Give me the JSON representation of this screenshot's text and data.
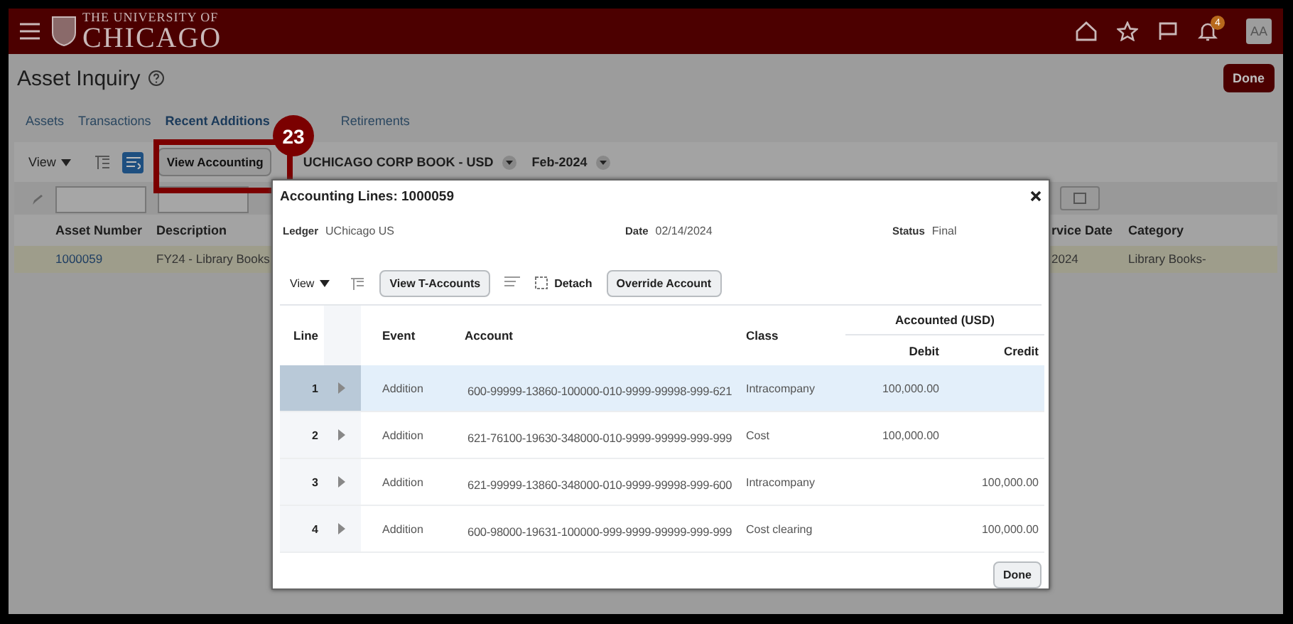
{
  "header": {
    "logo_line1": "THE UNIVERSITY OF",
    "logo_line2": "CHICAGO",
    "notification_count": "4",
    "avatar": "AA"
  },
  "page": {
    "title": "Asset Inquiry",
    "done_button": "Done",
    "tabs": [
      {
        "label": "Assets",
        "selected": false
      },
      {
        "label": "Transactions",
        "selected": false
      },
      {
        "label": "Recent Additions",
        "selected": true
      },
      {
        "label": "Retirements",
        "selected": false
      }
    ],
    "toolbar": {
      "view_menu": "View",
      "view_accounting_button": "View Accounting",
      "book": "UCHICAGO CORP BOOK - USD",
      "period": "Feb-2024"
    },
    "table": {
      "columns": [
        "Asset Number",
        "Description",
        "rvice Date",
        "Category"
      ],
      "rows": [
        {
          "cells": [
            "1000059",
            "FY24 - Library Books",
            "2024",
            "Library Books-"
          ],
          "selected": true
        }
      ]
    }
  },
  "callout": {
    "number": "23"
  },
  "dialog": {
    "title": "Accounting Lines: 1000059",
    "fields": [
      {
        "label": "Ledger",
        "value": "UChicago US"
      },
      {
        "label": "Date",
        "value": "02/14/2024"
      },
      {
        "label": "Status",
        "value": "Final"
      }
    ],
    "toolbar": {
      "view_menu": "View",
      "buttons": [
        {
          "label": "View T-Accounts",
          "kind": "button"
        },
        {
          "label": "Detach",
          "kind": "icon-text"
        },
        {
          "label": "Override Account",
          "kind": "button"
        }
      ]
    },
    "columns": {
      "line": "Line",
      "event": "Event",
      "account": "Account",
      "class": "Class",
      "group": "Accounted (USD)",
      "debit": "Debit",
      "credit": "Credit"
    },
    "rows": [
      {
        "line": "1",
        "event": "Addition",
        "account": "600-99999-13860-100000-010-9999-99998-999-621",
        "class": "Intracompany",
        "debit": "100,000.00",
        "selected": true
      },
      {
        "line": "2",
        "event": "Addition",
        "account": "621-76100-19630-348000-010-9999-99999-999-999",
        "class": "Cost",
        "debit": "100,000.00",
        "selected": false
      },
      {
        "line": "3",
        "event": "Addition",
        "account": "621-99999-13860-348000-010-9999-99998-999-600",
        "class": "Intracompany",
        "credit": "100,000.00",
        "selected": false
      },
      {
        "line": "4",
        "event": "Addition",
        "account": "600-98000-19631-100000-999-9999-99999-999-999",
        "class": "Cost clearing",
        "credit": "100,000.00",
        "selected": false
      }
    ],
    "done_button": "Done"
  }
}
